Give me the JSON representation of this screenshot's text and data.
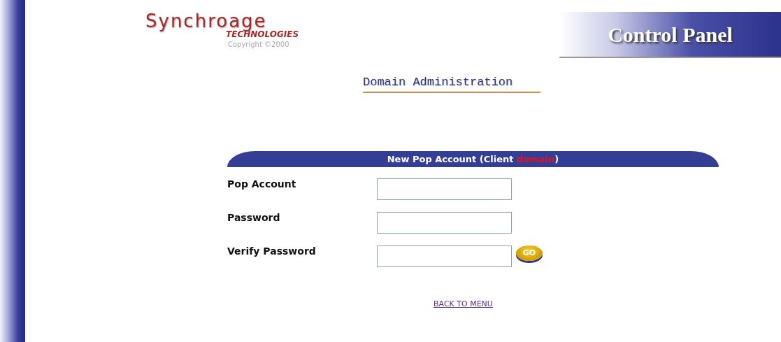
{
  "logo": {
    "name": "Synchroage",
    "tagline": "TECHNOLOGIES",
    "copyright": "Copyright ©2000"
  },
  "banner": {
    "title": "Control Panel"
  },
  "page_title": "Domain Administration",
  "form": {
    "header": {
      "before": "New Pop Account (Client",
      "highlight": "domain",
      "after": ")"
    },
    "fields": [
      {
        "label": "Pop Account"
      },
      {
        "label": "Password"
      },
      {
        "label": "Verify Password"
      }
    ],
    "submit": "GO"
  },
  "back_link": "BACK TO MENU"
}
